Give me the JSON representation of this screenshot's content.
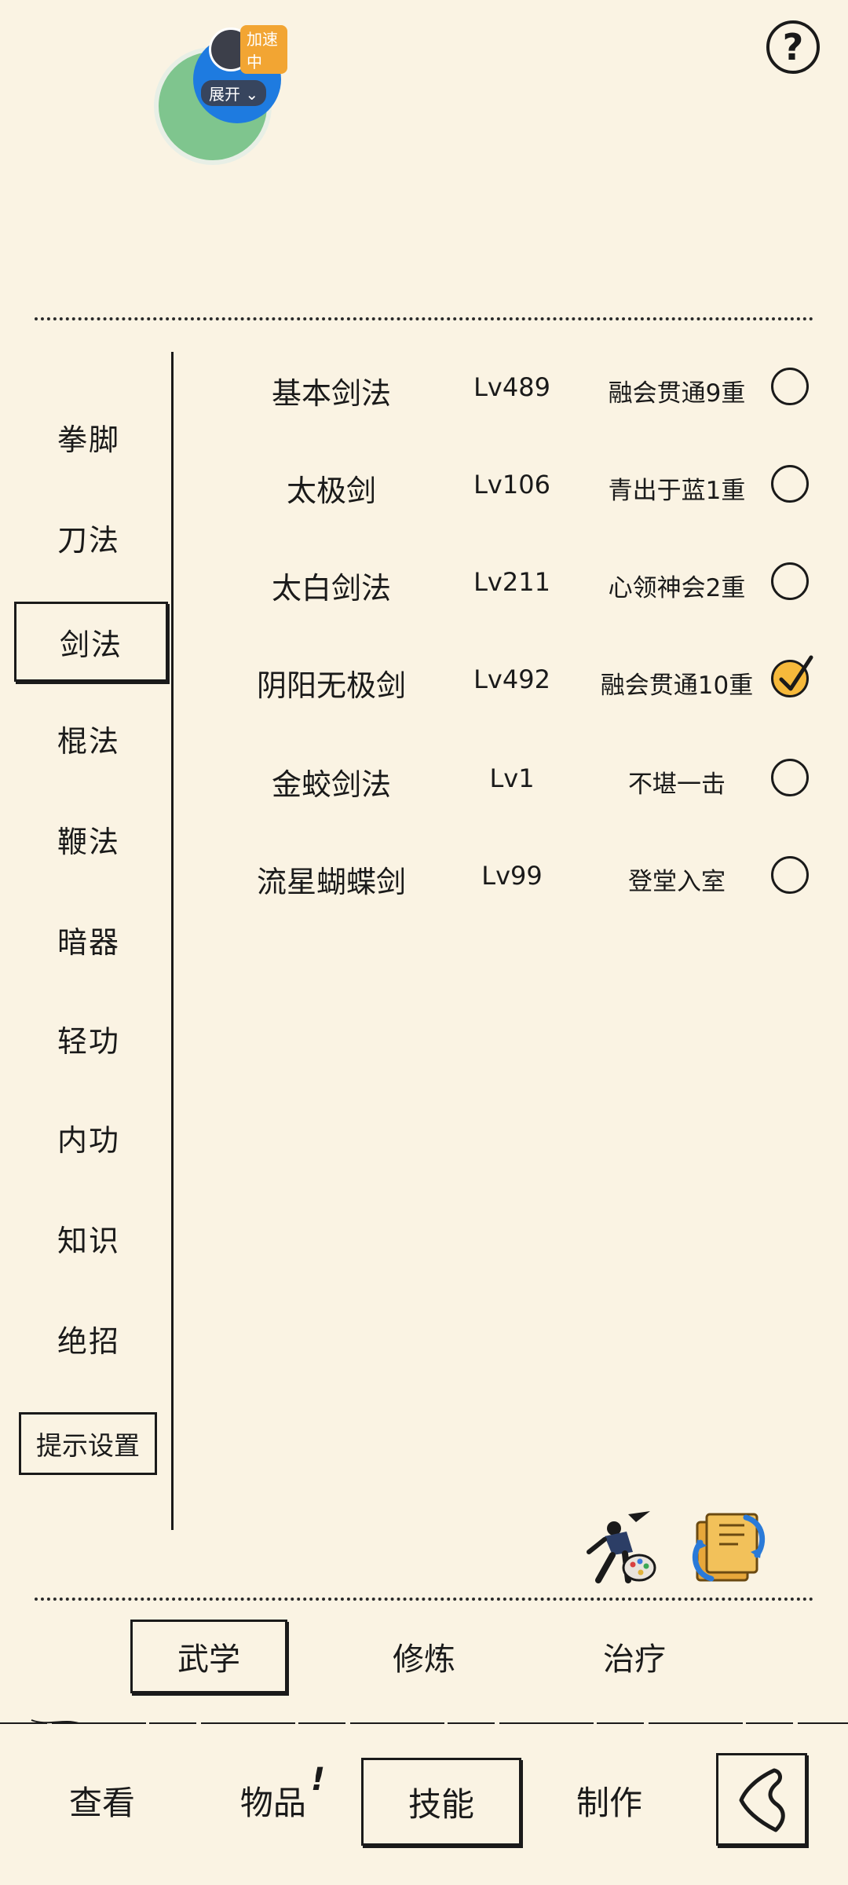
{
  "floating_widget": {
    "accelerating_badge": "加速中",
    "expand_label": "展开"
  },
  "help": {
    "symbol": "?"
  },
  "sidebar": {
    "items": [
      {
        "label": "拳脚",
        "selected": false
      },
      {
        "label": "刀法",
        "selected": false
      },
      {
        "label": "剑法",
        "selected": true
      },
      {
        "label": "棍法",
        "selected": false
      },
      {
        "label": "鞭法",
        "selected": false
      },
      {
        "label": "暗器",
        "selected": false
      },
      {
        "label": "轻功",
        "selected": false
      },
      {
        "label": "内功",
        "selected": false
      },
      {
        "label": "知识",
        "selected": false
      },
      {
        "label": "绝招",
        "selected": false
      }
    ],
    "hint_settings_label": "提示设置"
  },
  "skills": [
    {
      "name": "基本剑法",
      "level": "Lv489",
      "rank": "融会贯通9重",
      "checked": false
    },
    {
      "name": "太极剑",
      "level": "Lv106",
      "rank": "青出于蓝1重",
      "checked": false
    },
    {
      "name": "太白剑法",
      "level": "Lv211",
      "rank": "心领神会2重",
      "checked": false
    },
    {
      "name": "阴阳无极剑",
      "level": "Lv492",
      "rank": "融会贯通10重",
      "checked": true
    },
    {
      "name": "金蛟剑法",
      "level": "Lv1",
      "rank": "不堪一击",
      "checked": false
    },
    {
      "name": "流星蝴蝶剑",
      "level": "Lv99",
      "rank": "登堂入室",
      "checked": false
    }
  ],
  "sub_tabs": [
    {
      "label": "武学",
      "selected": true
    },
    {
      "label": "修炼",
      "selected": false
    },
    {
      "label": "治疗",
      "selected": false
    }
  ],
  "bottom_nav": [
    {
      "label": "查看",
      "selected": false
    },
    {
      "label": "物品",
      "selected": false,
      "alert": "!"
    },
    {
      "label": "技能",
      "selected": true
    },
    {
      "label": "制作",
      "selected": false
    }
  ],
  "colors": {
    "background": "#faf3e3",
    "ink": "#1a1a1a",
    "check_fill": "#f6b93b"
  }
}
